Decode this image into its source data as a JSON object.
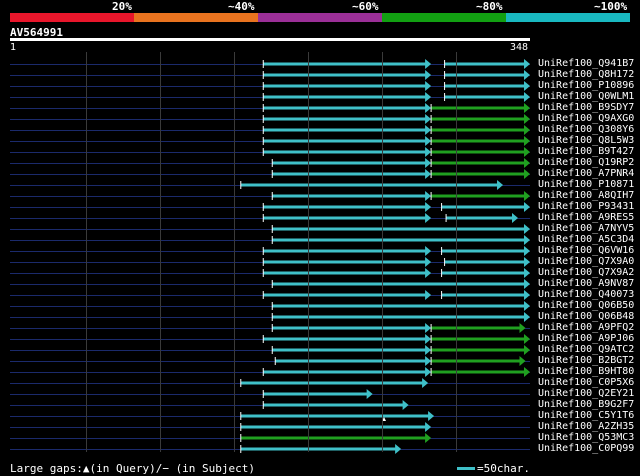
{
  "colors": {
    "band_20": "#e8162b",
    "band_40": "#e8731f",
    "band_60": "#9b2f97",
    "band_80": "#12a012",
    "band_100": "#19b8c0",
    "cyan": "#3fc0c8",
    "green": "#20a020",
    "track": "#1b2a6b"
  },
  "identity_scale": [
    {
      "label": "20%",
      "color": "#e8162b"
    },
    {
      "label": "~40%",
      "color": "#e8731f"
    },
    {
      "label": "~60%",
      "color": "#9b2f97"
    },
    {
      "label": "~80%",
      "color": "#12a012"
    },
    {
      "label": "~100%",
      "color": "#19b8c0"
    }
  ],
  "query": {
    "name": "AV564991",
    "start": "1",
    "end": "348",
    "length": 348
  },
  "hits": [
    {
      "name": "UniRef100_Q941B7",
      "segments": [
        [
          170,
          282,
          "cyan"
        ],
        [
          291,
          348,
          "cyan"
        ]
      ]
    },
    {
      "name": "UniRef100_Q8H172",
      "segments": [
        [
          170,
          282,
          "cyan"
        ],
        [
          291,
          348,
          "cyan"
        ]
      ]
    },
    {
      "name": "UniRef100_P10896",
      "segments": [
        [
          170,
          282,
          "cyan"
        ],
        [
          291,
          348,
          "cyan"
        ]
      ]
    },
    {
      "name": "UniRef100_Q0WLM1",
      "segments": [
        [
          170,
          282,
          "cyan"
        ],
        [
          291,
          348,
          "cyan"
        ]
      ]
    },
    {
      "name": "UniRef100_B9SDY7",
      "segments": [
        [
          170,
          282,
          "cyan"
        ],
        [
          282,
          348,
          "green"
        ]
      ]
    },
    {
      "name": "UniRef100_Q9AXG0",
      "segments": [
        [
          170,
          282,
          "cyan"
        ],
        [
          282,
          348,
          "green"
        ]
      ]
    },
    {
      "name": "UniRef100_Q308Y6",
      "segments": [
        [
          170,
          282,
          "cyan"
        ],
        [
          282,
          348,
          "green"
        ]
      ]
    },
    {
      "name": "UniRef100_Q8L5W3",
      "segments": [
        [
          170,
          282,
          "cyan"
        ],
        [
          282,
          348,
          "green"
        ]
      ]
    },
    {
      "name": "UniRef100_B9T427",
      "segments": [
        [
          170,
          282,
          "cyan"
        ],
        [
          282,
          348,
          "green"
        ]
      ]
    },
    {
      "name": "UniRef100_Q19RP2",
      "segments": [
        [
          176,
          282,
          "cyan"
        ],
        [
          282,
          348,
          "green"
        ]
      ]
    },
    {
      "name": "UniRef100_A7PNR4",
      "segments": [
        [
          176,
          282,
          "cyan"
        ],
        [
          282,
          348,
          "green"
        ]
      ]
    },
    {
      "name": "UniRef100_P10871",
      "segments": [
        [
          155,
          330,
          "cyan"
        ]
      ]
    },
    {
      "name": "UniRef100_A8QIH7",
      "segments": [
        [
          176,
          282,
          "cyan"
        ],
        [
          282,
          348,
          "green"
        ]
      ]
    },
    {
      "name": "UniRef100_P93431",
      "segments": [
        [
          170,
          282,
          "cyan"
        ],
        [
          289,
          348,
          "cyan"
        ]
      ]
    },
    {
      "name": "UniRef100_A9RES5",
      "segments": [
        [
          170,
          282,
          "cyan"
        ],
        [
          292,
          340,
          "cyan"
        ]
      ]
    },
    {
      "name": "UniRef100_A7NYV5",
      "segments": [
        [
          176,
          348,
          "cyan"
        ]
      ]
    },
    {
      "name": "UniRef100_A5C3D4",
      "segments": [
        [
          176,
          348,
          "cyan"
        ]
      ]
    },
    {
      "name": "UniRef100_Q6VW16",
      "segments": [
        [
          170,
          282,
          "cyan"
        ],
        [
          289,
          348,
          "cyan"
        ]
      ]
    },
    {
      "name": "UniRef100_Q7X9A0",
      "segments": [
        [
          170,
          282,
          "cyan"
        ],
        [
          291,
          348,
          "cyan"
        ]
      ]
    },
    {
      "name": "UniRef100_Q7X9A2",
      "segments": [
        [
          170,
          282,
          "cyan"
        ],
        [
          289,
          348,
          "cyan"
        ]
      ]
    },
    {
      "name": "UniRef100_A9NV87",
      "segments": [
        [
          176,
          348,
          "cyan"
        ]
      ]
    },
    {
      "name": "UniRef100_Q40073",
      "segments": [
        [
          170,
          282,
          "cyan"
        ],
        [
          289,
          348,
          "cyan"
        ]
      ]
    },
    {
      "name": "UniRef100_Q06B50",
      "segments": [
        [
          176,
          348,
          "cyan"
        ]
      ]
    },
    {
      "name": "UniRef100_Q06B48",
      "segments": [
        [
          176,
          348,
          "cyan"
        ]
      ]
    },
    {
      "name": "UniRef100_A9PFQ2",
      "segments": [
        [
          176,
          282,
          "cyan"
        ],
        [
          282,
          345,
          "green"
        ]
      ]
    },
    {
      "name": "UniRef100_A9PJ06",
      "segments": [
        [
          170,
          282,
          "cyan"
        ],
        [
          282,
          348,
          "green"
        ]
      ]
    },
    {
      "name": "UniRef100_Q9ATC2",
      "segments": [
        [
          176,
          282,
          "cyan"
        ],
        [
          282,
          348,
          "green"
        ]
      ]
    },
    {
      "name": "UniRef100_B2BGT2",
      "segments": [
        [
          178,
          282,
          "cyan"
        ],
        [
          282,
          345,
          "green"
        ]
      ]
    },
    {
      "name": "UniRef100_B9HT80",
      "segments": [
        [
          170,
          282,
          "cyan"
        ],
        [
          282,
          348,
          "green"
        ]
      ]
    },
    {
      "name": "UniRef100_C0P5X6",
      "segments": [
        [
          155,
          280,
          "cyan"
        ]
      ]
    },
    {
      "name": "UniRef100_Q2EY21",
      "segments": [
        [
          170,
          243,
          "cyan"
        ]
      ]
    },
    {
      "name": "UniRef100_B9G2F7",
      "segments": [
        [
          170,
          267,
          "cyan"
        ]
      ]
    },
    {
      "name": "UniRef100_C5Y1T6",
      "segments": [
        [
          155,
          284,
          "cyan"
        ]
      ]
    },
    {
      "name": "UniRef100_A2ZH35",
      "segments": [
        [
          155,
          282,
          "cyan"
        ]
      ]
    },
    {
      "name": "UniRef100_Q53MC3",
      "segments": [
        [
          155,
          282,
          "green"
        ]
      ]
    },
    {
      "name": "UniRef100_C0PQ99",
      "segments": [
        [
          155,
          262,
          "cyan"
        ]
      ]
    }
  ],
  "legend": {
    "gaps_text": "Large gaps:▲(in Query)/− (in Subject)",
    "scale_text": "=50char."
  }
}
